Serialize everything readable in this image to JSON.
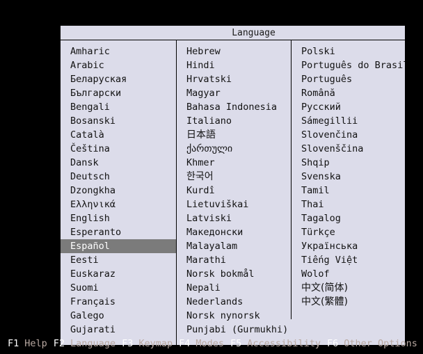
{
  "window": {
    "title": "Language"
  },
  "colors": {
    "screen_background": "#000000",
    "panel_background": "#dcdcea",
    "panel_border": "#000000",
    "selection_background": "#7b7b7b",
    "selection_text": "#ffffff",
    "text": "#121212",
    "fnkey_text": "#ffffff",
    "fnlabel_text": "#b9a9a2"
  },
  "selection": {
    "selected_language": "Español"
  },
  "columns": [
    {
      "name": "column-1",
      "items": [
        "Amharic",
        "Arabic",
        "Беларуская",
        "Български",
        "Bengali",
        "Bosanski",
        "Català",
        "Čeština",
        "Dansk",
        "Deutsch",
        "Dzongkha",
        "Ελληνικά",
        "English",
        "Esperanto",
        "Español",
        "Eesti",
        "Euskaraz",
        "Suomi",
        "Français",
        "Galego",
        "Gujarati"
      ]
    },
    {
      "name": "column-2",
      "items": [
        "Hebrew",
        "Hindi",
        "Hrvatski",
        "Magyar",
        "Bahasa Indonesia",
        "Italiano",
        "日本語",
        "ქართული",
        "Khmer",
        "한국어",
        "Kurdî",
        "Lietuviškai",
        "Latviski",
        "Македонски",
        "Malayalam",
        "Marathi",
        "Norsk bokmål",
        "Nepali",
        "Nederlands",
        "Norsk nynorsk",
        "Punjabi (Gurmukhi)"
      ]
    },
    {
      "name": "column-3",
      "items": [
        "Polski",
        "Português do Brasil",
        "Português",
        "Română",
        "Русский",
        "Sámegillii",
        "Slovenčina",
        "Slovenščina",
        "Shqip",
        "Svenska",
        "Tamil",
        "Thai",
        "Tagalog",
        "Türkçe",
        "Українська",
        "Tiếng Việt",
        "Wolof",
        "中文(简体)",
        "中文(繁體)"
      ]
    }
  ],
  "function_bar": [
    {
      "key": "F1",
      "label": "Help"
    },
    {
      "key": "F2",
      "label": "Language"
    },
    {
      "key": "F3",
      "label": "Keymap"
    },
    {
      "key": "F4",
      "label": "Modes"
    },
    {
      "key": "F5",
      "label": "Accessibility"
    },
    {
      "key": "F6",
      "label": "Other Options"
    }
  ]
}
